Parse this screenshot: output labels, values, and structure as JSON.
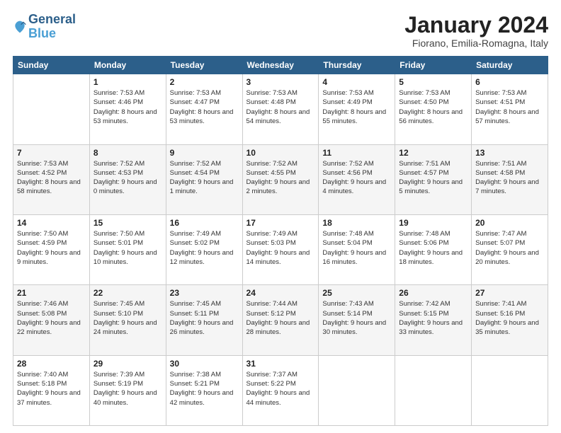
{
  "header": {
    "logo_line1": "General",
    "logo_line2": "Blue",
    "month_title": "January 2024",
    "location": "Fiorano, Emilia-Romagna, Italy"
  },
  "weekdays": [
    "Sunday",
    "Monday",
    "Tuesday",
    "Wednesday",
    "Thursday",
    "Friday",
    "Saturday"
  ],
  "weeks": [
    [
      {
        "day": "",
        "sunrise": "",
        "sunset": "",
        "daylight": ""
      },
      {
        "day": "1",
        "sunrise": "Sunrise: 7:53 AM",
        "sunset": "Sunset: 4:46 PM",
        "daylight": "Daylight: 8 hours and 53 minutes."
      },
      {
        "day": "2",
        "sunrise": "Sunrise: 7:53 AM",
        "sunset": "Sunset: 4:47 PM",
        "daylight": "Daylight: 8 hours and 53 minutes."
      },
      {
        "day": "3",
        "sunrise": "Sunrise: 7:53 AM",
        "sunset": "Sunset: 4:48 PM",
        "daylight": "Daylight: 8 hours and 54 minutes."
      },
      {
        "day": "4",
        "sunrise": "Sunrise: 7:53 AM",
        "sunset": "Sunset: 4:49 PM",
        "daylight": "Daylight: 8 hours and 55 minutes."
      },
      {
        "day": "5",
        "sunrise": "Sunrise: 7:53 AM",
        "sunset": "Sunset: 4:50 PM",
        "daylight": "Daylight: 8 hours and 56 minutes."
      },
      {
        "day": "6",
        "sunrise": "Sunrise: 7:53 AM",
        "sunset": "Sunset: 4:51 PM",
        "daylight": "Daylight: 8 hours and 57 minutes."
      }
    ],
    [
      {
        "day": "7",
        "sunrise": "Sunrise: 7:53 AM",
        "sunset": "Sunset: 4:52 PM",
        "daylight": "Daylight: 8 hours and 58 minutes."
      },
      {
        "day": "8",
        "sunrise": "Sunrise: 7:52 AM",
        "sunset": "Sunset: 4:53 PM",
        "daylight": "Daylight: 9 hours and 0 minutes."
      },
      {
        "day": "9",
        "sunrise": "Sunrise: 7:52 AM",
        "sunset": "Sunset: 4:54 PM",
        "daylight": "Daylight: 9 hours and 1 minute."
      },
      {
        "day": "10",
        "sunrise": "Sunrise: 7:52 AM",
        "sunset": "Sunset: 4:55 PM",
        "daylight": "Daylight: 9 hours and 2 minutes."
      },
      {
        "day": "11",
        "sunrise": "Sunrise: 7:52 AM",
        "sunset": "Sunset: 4:56 PM",
        "daylight": "Daylight: 9 hours and 4 minutes."
      },
      {
        "day": "12",
        "sunrise": "Sunrise: 7:51 AM",
        "sunset": "Sunset: 4:57 PM",
        "daylight": "Daylight: 9 hours and 5 minutes."
      },
      {
        "day": "13",
        "sunrise": "Sunrise: 7:51 AM",
        "sunset": "Sunset: 4:58 PM",
        "daylight": "Daylight: 9 hours and 7 minutes."
      }
    ],
    [
      {
        "day": "14",
        "sunrise": "Sunrise: 7:50 AM",
        "sunset": "Sunset: 4:59 PM",
        "daylight": "Daylight: 9 hours and 9 minutes."
      },
      {
        "day": "15",
        "sunrise": "Sunrise: 7:50 AM",
        "sunset": "Sunset: 5:01 PM",
        "daylight": "Daylight: 9 hours and 10 minutes."
      },
      {
        "day": "16",
        "sunrise": "Sunrise: 7:49 AM",
        "sunset": "Sunset: 5:02 PM",
        "daylight": "Daylight: 9 hours and 12 minutes."
      },
      {
        "day": "17",
        "sunrise": "Sunrise: 7:49 AM",
        "sunset": "Sunset: 5:03 PM",
        "daylight": "Daylight: 9 hours and 14 minutes."
      },
      {
        "day": "18",
        "sunrise": "Sunrise: 7:48 AM",
        "sunset": "Sunset: 5:04 PM",
        "daylight": "Daylight: 9 hours and 16 minutes."
      },
      {
        "day": "19",
        "sunrise": "Sunrise: 7:48 AM",
        "sunset": "Sunset: 5:06 PM",
        "daylight": "Daylight: 9 hours and 18 minutes."
      },
      {
        "day": "20",
        "sunrise": "Sunrise: 7:47 AM",
        "sunset": "Sunset: 5:07 PM",
        "daylight": "Daylight: 9 hours and 20 minutes."
      }
    ],
    [
      {
        "day": "21",
        "sunrise": "Sunrise: 7:46 AM",
        "sunset": "Sunset: 5:08 PM",
        "daylight": "Daylight: 9 hours and 22 minutes."
      },
      {
        "day": "22",
        "sunrise": "Sunrise: 7:45 AM",
        "sunset": "Sunset: 5:10 PM",
        "daylight": "Daylight: 9 hours and 24 minutes."
      },
      {
        "day": "23",
        "sunrise": "Sunrise: 7:45 AM",
        "sunset": "Sunset: 5:11 PM",
        "daylight": "Daylight: 9 hours and 26 minutes."
      },
      {
        "day": "24",
        "sunrise": "Sunrise: 7:44 AM",
        "sunset": "Sunset: 5:12 PM",
        "daylight": "Daylight: 9 hours and 28 minutes."
      },
      {
        "day": "25",
        "sunrise": "Sunrise: 7:43 AM",
        "sunset": "Sunset: 5:14 PM",
        "daylight": "Daylight: 9 hours and 30 minutes."
      },
      {
        "day": "26",
        "sunrise": "Sunrise: 7:42 AM",
        "sunset": "Sunset: 5:15 PM",
        "daylight": "Daylight: 9 hours and 33 minutes."
      },
      {
        "day": "27",
        "sunrise": "Sunrise: 7:41 AM",
        "sunset": "Sunset: 5:16 PM",
        "daylight": "Daylight: 9 hours and 35 minutes."
      }
    ],
    [
      {
        "day": "28",
        "sunrise": "Sunrise: 7:40 AM",
        "sunset": "Sunset: 5:18 PM",
        "daylight": "Daylight: 9 hours and 37 minutes."
      },
      {
        "day": "29",
        "sunrise": "Sunrise: 7:39 AM",
        "sunset": "Sunset: 5:19 PM",
        "daylight": "Daylight: 9 hours and 40 minutes."
      },
      {
        "day": "30",
        "sunrise": "Sunrise: 7:38 AM",
        "sunset": "Sunset: 5:21 PM",
        "daylight": "Daylight: 9 hours and 42 minutes."
      },
      {
        "day": "31",
        "sunrise": "Sunrise: 7:37 AM",
        "sunset": "Sunset: 5:22 PM",
        "daylight": "Daylight: 9 hours and 44 minutes."
      },
      {
        "day": "",
        "sunrise": "",
        "sunset": "",
        "daylight": ""
      },
      {
        "day": "",
        "sunrise": "",
        "sunset": "",
        "daylight": ""
      },
      {
        "day": "",
        "sunrise": "",
        "sunset": "",
        "daylight": ""
      }
    ]
  ]
}
